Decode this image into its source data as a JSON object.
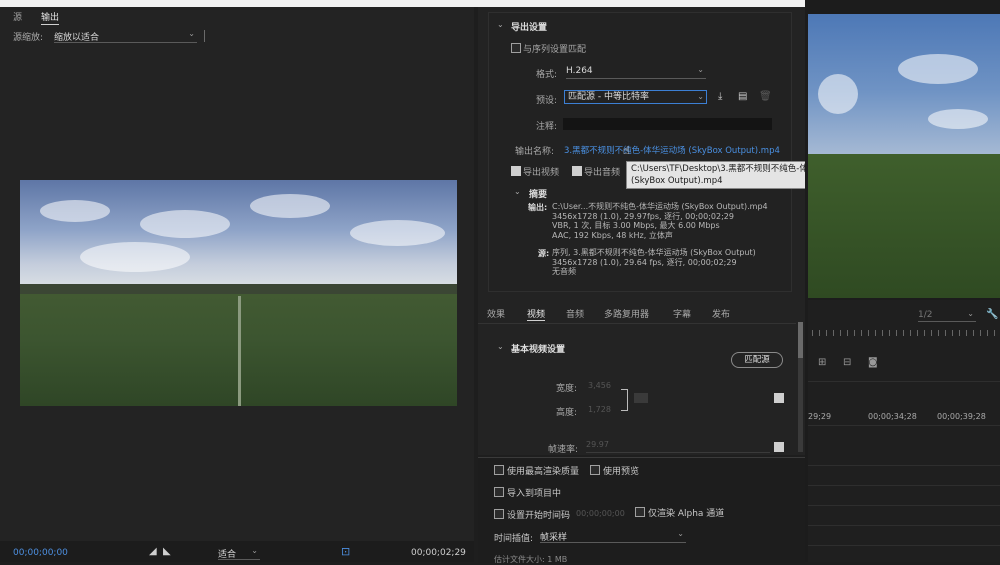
{
  "left_panel": {
    "tabs": [
      "源",
      "输出"
    ],
    "source_scale_label": "源缩放:",
    "source_scale_value": "缩放以适合",
    "timecode_start": "00;00;00;00",
    "fit_value": "适合",
    "timecode_end": "00;00;02;29"
  },
  "export": {
    "section_title": "导出设置",
    "match_sequence_label": "与序列设置匹配",
    "format_label": "格式:",
    "format_value": "H.264",
    "preset_label": "预设:",
    "preset_value": "匹配源 - 中等比特率",
    "comment_label": "注释:",
    "output_name_label": "输出名称:",
    "output_name_value": "3.黑都不规则不纯色-体华运动场 (SkyBox Output).mp4",
    "export_video_label": "导出视频",
    "export_audio_label": "导出音频",
    "tooltip": "C:\\Users\\TF\\Desktop\\3.黑都不规则不纯色-体华运动场 (SkyBox Output).mp4",
    "summary_title": "摘要",
    "summary_output_label": "输出:",
    "summary_output_lines": [
      "C:\\User...不规则不纯色-体华运动场 (SkyBox Output).mp4",
      "3456x1728 (1.0), 29.97fps, 逐行, 00;00;02;29",
      "VBR, 1 次, 目标 3.00 Mbps, 最大 6.00 Mbps",
      "AAC, 192 Kbps, 48 kHz, 立体声"
    ],
    "summary_source_label": "源:",
    "summary_source_lines": [
      "序列, 3.黑都不规则不纯色-体华运动场 (SkyBox Output)",
      "3456x1728 (1.0), 29.64 fps, 逐行, 00;00;02;29",
      "无音频"
    ]
  },
  "settings_tabs": [
    "效果",
    "视频",
    "音频",
    "多路复用器",
    "字幕",
    "发布"
  ],
  "video": {
    "section_title": "基本视频设置",
    "match_source_button": "匹配源",
    "width_label": "宽度:",
    "width_value": "3,456",
    "height_label": "高度:",
    "height_value": "1,728",
    "frame_rate_label": "帧速率:",
    "frame_rate_value": "29.97"
  },
  "lower": {
    "max_render_quality": "使用最高渲染质量",
    "use_previews": "使用预览",
    "import_into_project": "导入到项目中",
    "set_start_timecode": "设置开始时间码",
    "start_timecode_value": "00;00;00;00",
    "render_alpha_only": "仅渲染 Alpha 通道",
    "time_interpolation_label": "时间插值:",
    "time_interpolation_value": "帧采样",
    "estimated_file_size": "估计文件大小: 1 MB"
  },
  "right_panel": {
    "zoom_value": "1/2",
    "timecodes": [
      "29;29",
      "00;00;34;28",
      "00;00;39;28"
    ]
  }
}
